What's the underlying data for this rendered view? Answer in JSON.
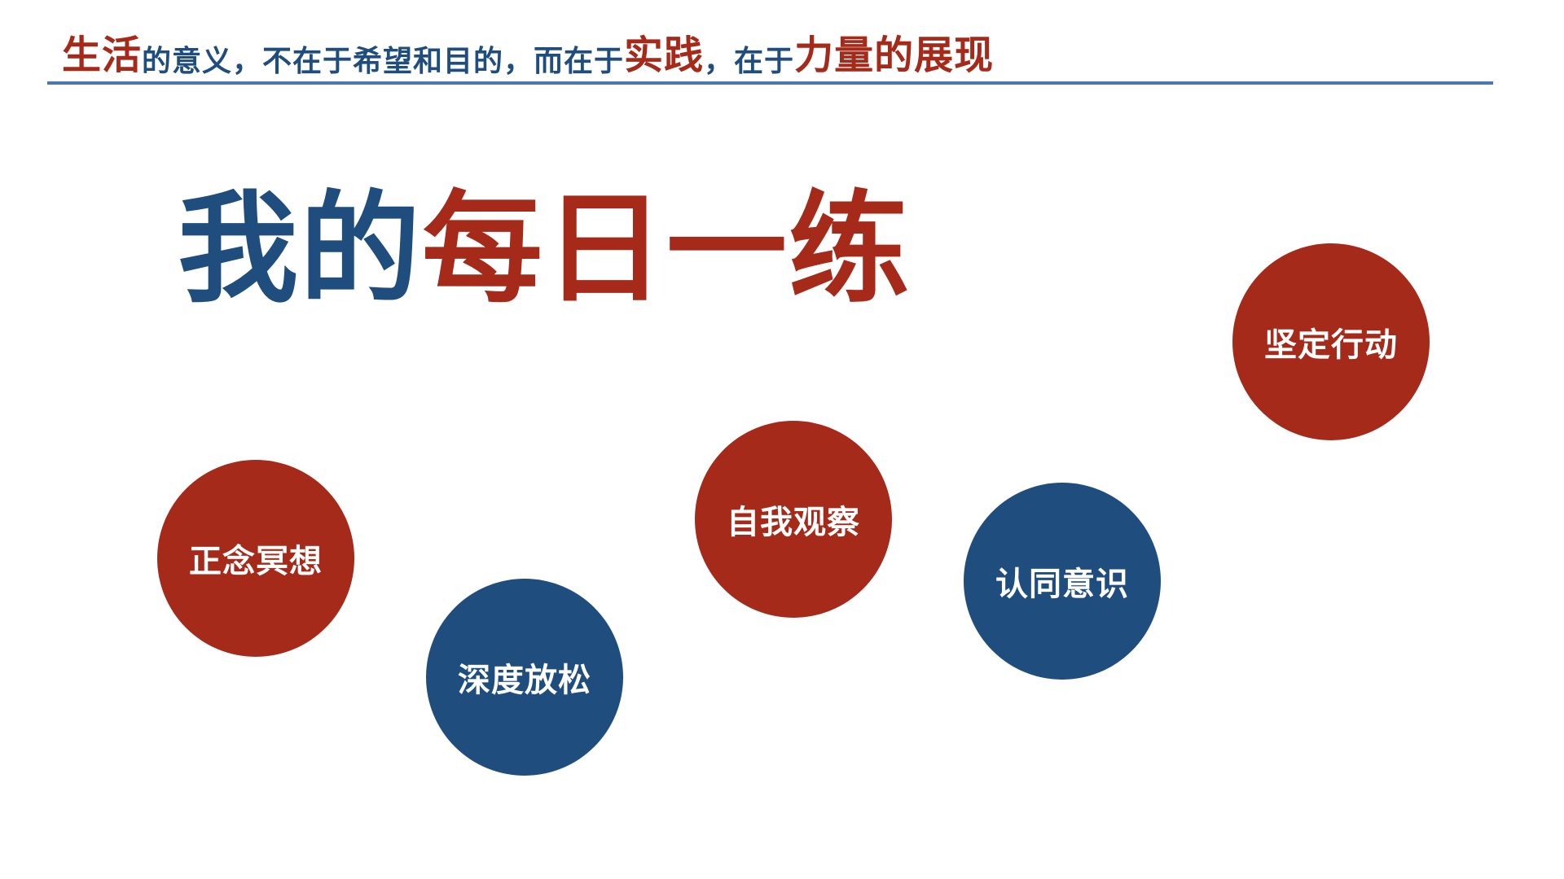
{
  "header": {
    "segments": [
      {
        "text": "生活",
        "color": "#a52a1a",
        "size": "big"
      },
      {
        "text": "的意义，不在于希望和目的，而在于",
        "color": "#1f4e7e",
        "size": "small"
      },
      {
        "text": "实践",
        "color": "#a52a1a",
        "size": "big"
      },
      {
        "text": "，在于",
        "color": "#1f4e7e",
        "size": "small"
      },
      {
        "text": "力量的展现",
        "color": "#a52a1a",
        "size": "big"
      }
    ],
    "rule_color": "#4a78b0"
  },
  "title": {
    "part1": "我的",
    "part2": "每日一练",
    "part1_color": "#1f4e7e",
    "part2_color": "#a52a1a"
  },
  "practices": [
    {
      "label": "正念冥想",
      "color": "red"
    },
    {
      "label": "深度放松",
      "color": "blue"
    },
    {
      "label": "自我观察",
      "color": "red"
    },
    {
      "label": "认同意识",
      "color": "blue"
    },
    {
      "label": "坚定行动",
      "color": "red"
    }
  ],
  "colors": {
    "red": "#a52a1a",
    "blue": "#1f4e7e"
  }
}
